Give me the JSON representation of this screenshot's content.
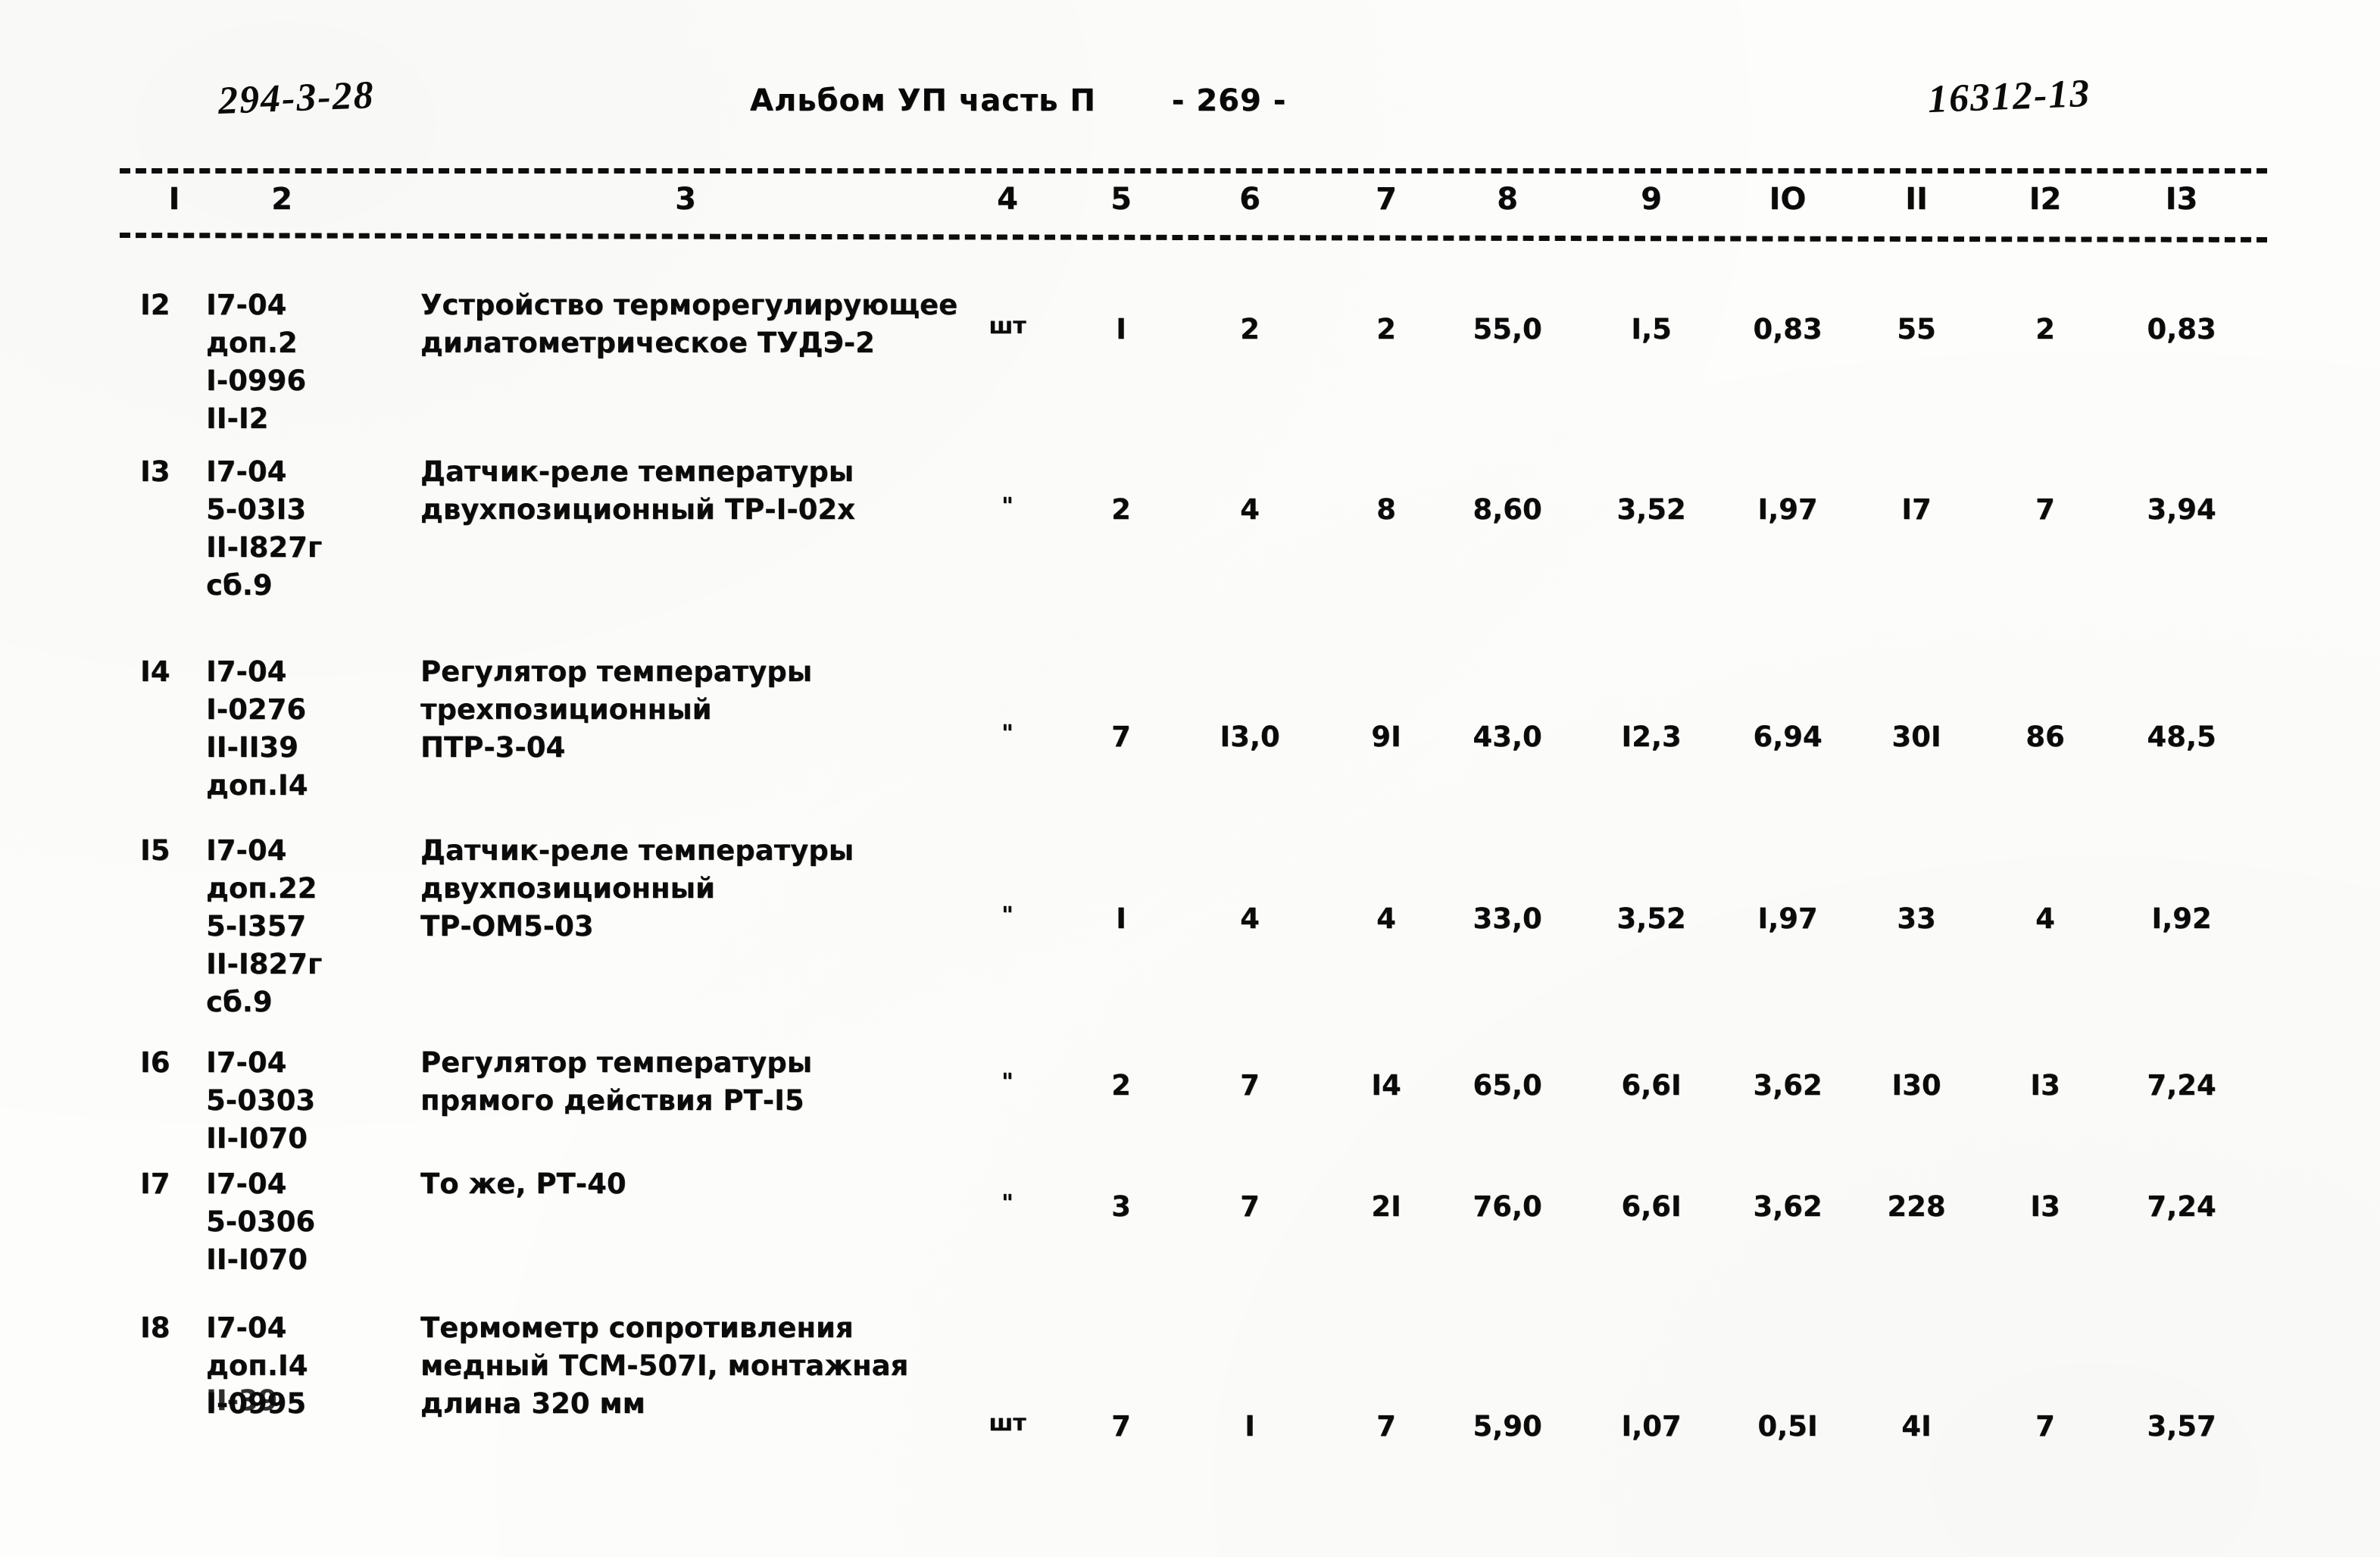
{
  "header": {
    "hand_left_code": "294-3-28",
    "hand_right_code": "16312-13",
    "album": "Альбом УП  часть П",
    "page_label": "- 269 -"
  },
  "table": {
    "column_numbers": [
      "I",
      "2",
      "3",
      "4",
      "5",
      "6",
      "7",
      "8",
      "9",
      "IO",
      "II",
      "I2",
      "I3"
    ],
    "rows": [
      {
        "num": "I2",
        "code": "I7-04\nдоп.2\nI-0996\nII-I2",
        "name": "Устройство терморегулирующее\nдилатометрическое ТУДЭ-2",
        "unit": "шт",
        "c5": "I",
        "c6": "2",
        "c7": "2",
        "c8": "55,0",
        "c9": "I,5",
        "c10": "0,83",
        "c11": "55",
        "c12": "2",
        "c13": "0,83"
      },
      {
        "num": "I3",
        "code": "I7-04\n5-03I3\nII-I827г\nсб.9",
        "name": "Датчик-реле температуры\nдвухпозиционный ТР-I-02х",
        "unit": "\"",
        "c5": "2",
        "c6": "4",
        "c7": "8",
        "c8": "8,60",
        "c9": "3,52",
        "c10": "I,97",
        "c11": "I7",
        "c12": "7",
        "c13": "3,94"
      },
      {
        "num": "I4",
        "code": "I7-04\nI-0276\nII-II39\nдоп.I4",
        "name": "Регулятор температуры\nтрехпозиционный\nПТР-3-04",
        "unit": "\"",
        "c5": "7",
        "c6": "I3,0",
        "c7": "9I",
        "c8": "43,0",
        "c9": "I2,3",
        "c10": "6,94",
        "c11": "30I",
        "c12": "86",
        "c13": "48,5"
      },
      {
        "num": "I5",
        "code": "I7-04\nдоп.22\n5-I357\nII-I827г\nсб.9",
        "name": "Датчик-реле температуры\nдвухпозиционный\nТР-ОМ5-03",
        "unit": "\"",
        "c5": "I",
        "c6": "4",
        "c7": "4",
        "c8": "33,0",
        "c9": "3,52",
        "c10": "I,97",
        "c11": "33",
        "c12": "4",
        "c13": "I,92"
      },
      {
        "num": "I6",
        "code": "I7-04\n5-0303\nII-I070",
        "name": "Регулятор температуры\nпрямого действия РТ-I5",
        "unit": "\"",
        "c5": "2",
        "c6": "7",
        "c7": "I4",
        "c8": "65,0",
        "c9": "6,6I",
        "c10": "3,62",
        "c11": "I30",
        "c12": "I3",
        "c13": "7,24"
      },
      {
        "num": "I7",
        "code": "I7-04\n5-0306\nII-I070",
        "name": "То же, РТ-40",
        "unit": "\"",
        "c5": "3",
        "c6": "7",
        "c7": "2I",
        "c8": "76,0",
        "c9": "6,6I",
        "c10": "3,62",
        "c11": "228",
        "c12": "I3",
        "c13": "7,24"
      },
      {
        "num": "I8",
        "code": "I7-04\nдоп.I4\nI-0995",
        "code_overstrike": "II-39",
        "name": "Термометр сопротивления\nмедный ТСМ-507I, монтажная\nдлина 320 мм",
        "unit": "шт",
        "c5": "7",
        "c6": "I",
        "c7": "7",
        "c8": "5,90",
        "c9": "I,07",
        "c10": "0,5I",
        "c11": "4I",
        "c12": "7",
        "c13": "3,57"
      }
    ]
  }
}
